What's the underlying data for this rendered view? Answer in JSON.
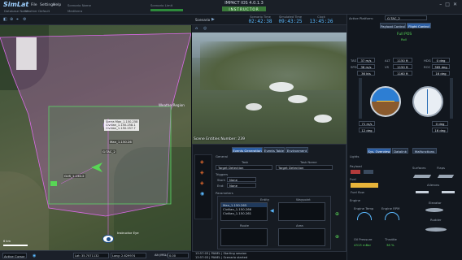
{
  "app": {
    "logo": "SimLat",
    "title": "IMPACT IOS 4.0.1.3",
    "instructor_badge": "INSTRUCTOR",
    "menu": [
      "File",
      "Settings",
      "Help"
    ],
    "sub_info": [
      "Database Name",
      "Weather Default",
      "Scenario Name",
      "Mediterra",
      "Scenario Limit",
      "Scenario"
    ]
  },
  "clocks": [
    {
      "label": "Scenario Time",
      "value": "02:42:38"
    },
    {
      "label": "Simulated Time",
      "value": "09:43:25"
    },
    {
      "label": "Clock",
      "value": "13:45:26"
    }
  ],
  "toolbar2": {
    "scenario_label": "Scenario"
  },
  "map": {
    "region_label": "WeatherRegion",
    "popup_lines": [
      "Sierra Man_1.150.258",
      "Civilian_1.150.258.1",
      "Civilian_1.150.257.7"
    ],
    "entity_labels": [
      "Man_1.150.26",
      "G:TAC_2",
      "GUS_1.150.2"
    ],
    "instructor_eye": "Instructor Eye",
    "scale_label": "6 km",
    "bottom_bar": {
      "cursor_mode": "Active Cursor",
      "lat": "Lat: 35.7071132",
      "lng": "Long: 2.629974",
      "alt": "Alt (MSL):",
      "alt_value": "0.00"
    }
  },
  "view3d": {
    "scene_entities": "Scene Entities Number: 239"
  },
  "events": {
    "general_label": "General",
    "tabs": [
      "Events Generation",
      "Events Table",
      "Environment"
    ],
    "task_label": "Task",
    "task_name_label": "Task Name",
    "task_value": "Target Detection",
    "task_name_value": "Target Detection",
    "triggers_label": "Triggers",
    "start_label": "Start:",
    "start_value": "None",
    "end_label": "End:",
    "end_value": "None",
    "parameters_label": "Parameters",
    "entity_label": "Entity",
    "waypoint_label": "Waypoint",
    "entities": [
      "Man_1.150.265",
      "Civilian_1.150.266",
      "Civilian_1.150.261"
    ],
    "route_label": "Route",
    "area_label": "Area"
  },
  "status": {
    "line1": "13:57:03 | PANEL | Starting session",
    "line2": "13:57:03 | PANEL | Scenario started"
  },
  "right": {
    "active_platform_label": "Active Platform:",
    "active_platform_value": "G:TAC_2",
    "payload_btn": "Payload Control",
    "flight_btn": "Flight Control",
    "full_pos": "Full POS",
    "full_pos_sub": "Roll",
    "readouts_left": [
      "37 m/s",
      "38 m/s",
      "36 kts"
    ],
    "readouts_mid": [
      "1150 ft",
      "1150 ft",
      "1160 ft"
    ],
    "readouts_right": [
      "0 deg",
      "365 deg",
      "16 deg"
    ],
    "readout_labels": [
      "TAS",
      "ALT",
      "HDG",
      "SPD",
      "VS",
      "ROC"
    ],
    "lower_boxes": [
      "71 m/s",
      "12 deg",
      "0 deg",
      "16 deg"
    ],
    "sys_tabs": [
      "Sys. Overview",
      "Datalink",
      "Malfunctions"
    ],
    "sections": [
      "Lights",
      "Payload",
      "Fuel",
      "Engine",
      "Surfaces",
      "Flaps",
      "Ailerons",
      "Elevator",
      "Rudder"
    ],
    "fuel_flow_label": "Fuel flow",
    "engine_temp_label": "Engine Temp",
    "engine_rpm_label": "Engine RPM",
    "oil_pressure_label": "Oil Pressure",
    "oil_pressure_value": "4313 mBar",
    "throttle_label": "Throttle",
    "throttle_value": "38 %",
    "speed_readout": "77 kts",
    "alt_readout": "1150 ft",
    "pitch_readout": "0 deg"
  },
  "colors": {
    "accent": "#5ab9ff",
    "active_tab": "#2d5fa4",
    "instructor_badge": "#3b7a3a",
    "weather_region": "#c95ad6",
    "area_green": "#3fa54a",
    "fuel_bar": "#e8b43a",
    "full_pos_text": "#57d957"
  }
}
